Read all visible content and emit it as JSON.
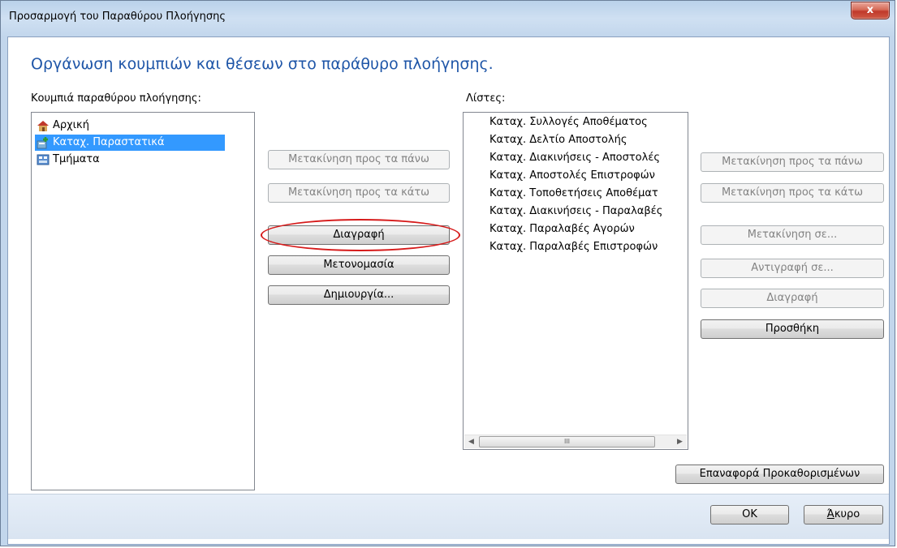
{
  "window": {
    "title": "Προσαρμογή του Παραθύρου Πλοήγησης",
    "close_glyph": "x"
  },
  "headline": "Οργάνωση κουμπιών και θέσεων στο παράθυρο πλοήγησης.",
  "left_panel": {
    "label": "Κουμπιά παραθύρου πλοήγησης:",
    "items": [
      {
        "label": "Αρχική",
        "icon": "home-icon",
        "selected": false
      },
      {
        "label": "Καταχ. Παραστατικά",
        "icon": "documents-icon",
        "selected": true
      },
      {
        "label": "Τμήματα",
        "icon": "departments-icon",
        "selected": false
      }
    ]
  },
  "middle_buttons": {
    "move_up": "Μετακίνηση προς τα πάνω",
    "move_down": "Μετακίνηση προς τα κάτω",
    "delete": "Διαγραφή",
    "rename": "Μετονομασία",
    "create": "Δημιουργία..."
  },
  "lists_panel": {
    "label": "Λίστες:",
    "items": [
      "Καταχ. Συλλογές Αποθέματος",
      "Καταχ. Δελτίο Αποστολής",
      "Καταχ. Διακινήσεις - Αποστολές",
      "Καταχ. Αποστολές Επιστροφών",
      "Καταχ. Τοποθετήσεις Αποθέματ",
      "Καταχ. Διακινήσεις - Παραλαβές",
      "Καταχ. Παραλαβές Αγορών",
      "Καταχ. Παραλαβές Επιστροφών"
    ],
    "scroll_thumb_glyph": "III"
  },
  "right_buttons": {
    "move_up": "Μετακίνηση προς τα πάνω",
    "move_down": "Μετακίνηση προς τα κάτω",
    "move_to": "Μετακίνηση σε...",
    "copy_to": "Αντιγραφή σε...",
    "delete": "Διαγραφή",
    "add": "Προσθήκη"
  },
  "reset_button": "Επαναφορά Προκαθορισμένων",
  "ok_button": "OK",
  "cancel_button": {
    "accel": "Ά",
    "rest": "κυρο"
  },
  "colors": {
    "headline": "#1f56a8",
    "selection": "#3399ff",
    "annotation": "#d61a1a"
  }
}
